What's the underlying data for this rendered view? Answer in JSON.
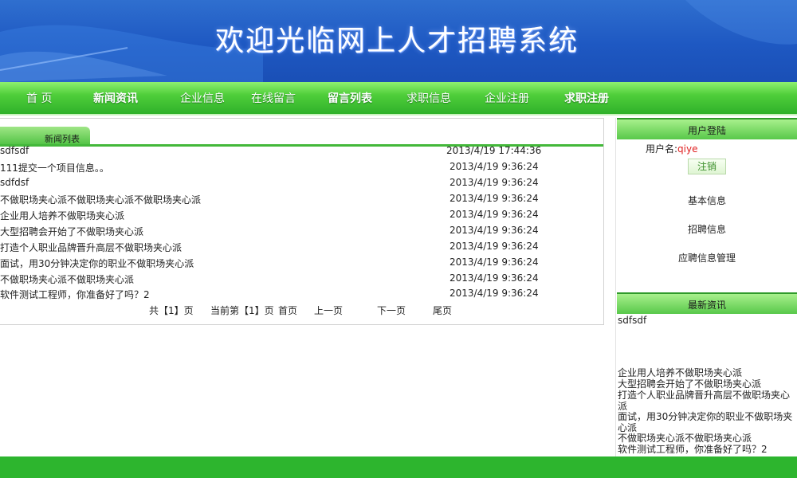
{
  "header": {
    "title": "欢迎光临网上人才招聘系统"
  },
  "nav": {
    "items": [
      "首 页",
      "新闻资讯",
      "企业信息",
      "在线留言",
      "留言列表",
      "求职信息",
      "企业注册",
      "求职注册"
    ]
  },
  "news": {
    "tab_label": "新闻列表",
    "rows": [
      {
        "title": "sdfsdf",
        "time": "2013/4/19 17:44:36"
      },
      {
        "title": "111提交一个项目信息。。",
        "time": "2013/4/19 9:36:24"
      },
      {
        "title": "sdfdsf",
        "time": "2013/4/19 9:36:24"
      },
      {
        "title": "不做职场夹心派不做职场夹心派不做职场夹心派",
        "time": "2013/4/19 9:36:24"
      },
      {
        "title": "企业用人培养不做职场夹心派",
        "time": "2013/4/19 9:36:24"
      },
      {
        "title": "大型招聘会开始了不做职场夹心派",
        "time": "2013/4/19 9:36:24"
      },
      {
        "title": "打造个人职业品牌晋升高层不做职场夹心派",
        "time": "2013/4/19 9:36:24"
      },
      {
        "title": "面试，用30分钟决定你的职业不做职场夹心派",
        "time": "2013/4/19 9:36:24"
      },
      {
        "title": "不做职场夹心派不做职场夹心派",
        "time": "2013/4/19 9:36:24"
      },
      {
        "title": "软件测试工程师，你准备好了吗？2",
        "time": "2013/4/19 9:36:24"
      }
    ],
    "pager": {
      "total": "共【1】页",
      "current": "当前第【1】页",
      "first": "首页",
      "prev": "上一页",
      "next": "下一页",
      "last": "尾页"
    }
  },
  "sidebar": {
    "login_header": "用户登陆",
    "username_label": "用户名:",
    "username": "qiye",
    "logout_label": "注销",
    "links": [
      "基本信息",
      "招聘信息",
      "应聘信息管理"
    ],
    "latest_header": "最新资讯",
    "latest_items": [
      "sdfsdf",
      "企业用人培养不做职场夹心派",
      "大型招聘会开始了不做职场夹心派",
      "打造个人职业品牌晋升高层不做职场夹心派",
      "面试，用30分钟决定你的职业不做职场夹心派",
      "不做职场夹心派不做职场夹心派",
      "软件测试工程师，你准备好了吗？2"
    ]
  },
  "colors": {
    "banner_blue": "#1e58c2",
    "nav_green": "#4fce3a",
    "footer_green": "#2db52e",
    "username_red": "#e02020"
  }
}
